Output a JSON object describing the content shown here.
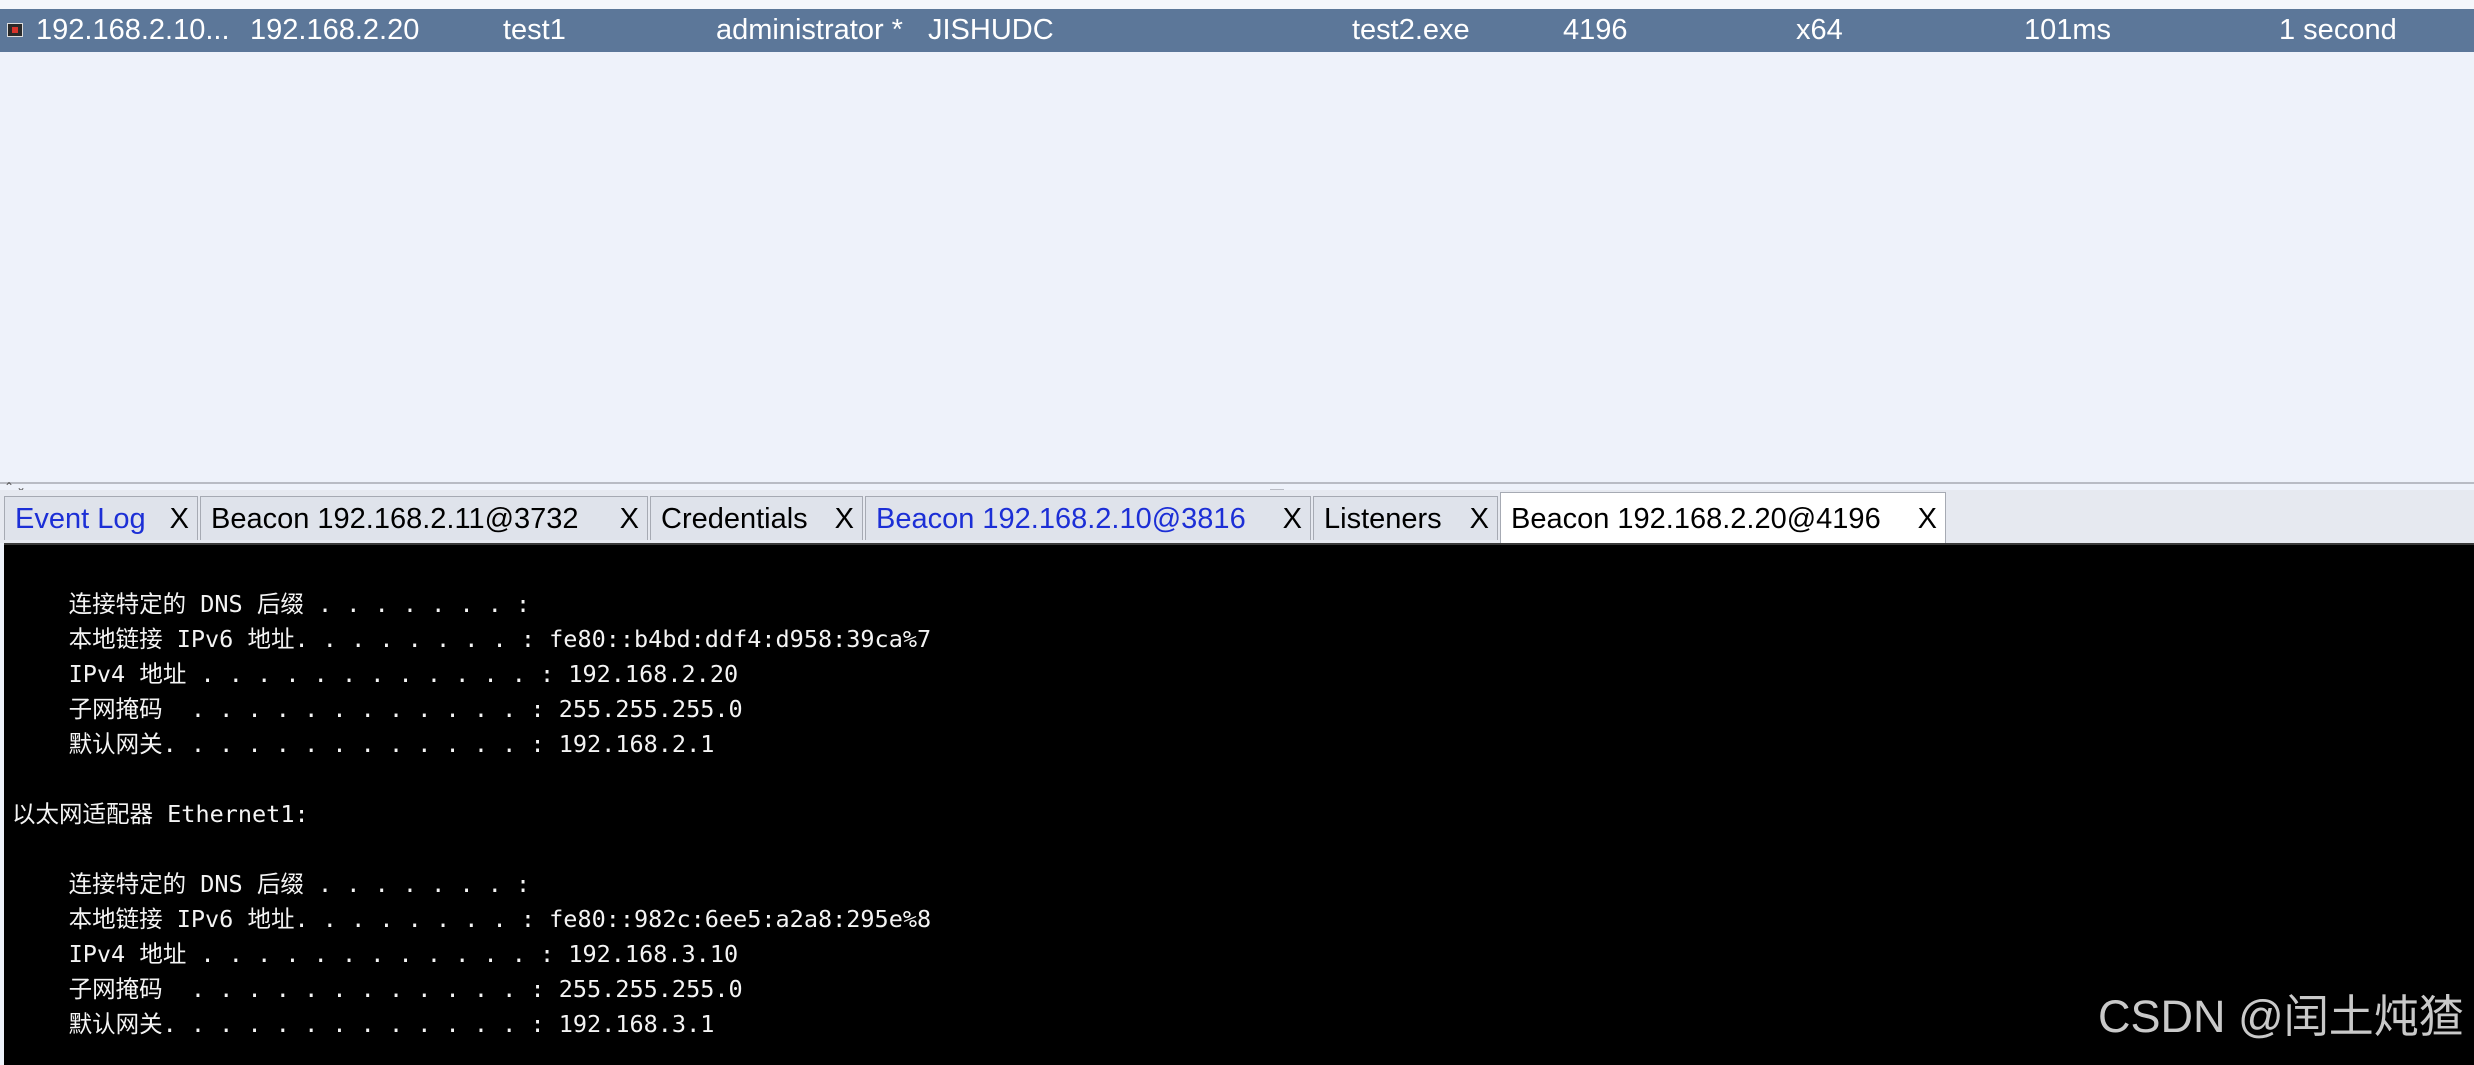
{
  "beacon_row": {
    "external": "192.168.2.10...",
    "internal": "192.168.2.20",
    "listener": "test1",
    "user": "administrator *",
    "computer": "JISHUDC",
    "process": "test2.exe",
    "pid": "4196",
    "arch": "x64",
    "sleep": "101ms",
    "last": "1 second"
  },
  "tabs": [
    {
      "label": "Event Log",
      "close": "X"
    },
    {
      "label": "Beacon 192.168.2.11@3732",
      "close": "X"
    },
    {
      "label": "Credentials",
      "close": "X"
    },
    {
      "label": "Beacon 192.168.2.10@3816",
      "close": "X"
    },
    {
      "label": "Listeners",
      "close": "X"
    },
    {
      "label": "Beacon 192.168.2.20@4196",
      "close": "X"
    }
  ],
  "console_lines": [
    "    连接特定的 DNS 后缀 . . . . . . . :",
    "    本地链接 IPv6 地址. . . . . . . . : fe80::b4bd:ddf4:d958:39ca%7",
    "    IPv4 地址 . . . . . . . . . . . . : 192.168.2.20",
    "    子网掩码  . . . . . . . . . . . . : 255.255.255.0",
    "    默认网关. . . . . . . . . . . . . : 192.168.2.1",
    "",
    "以太网适配器 Ethernet1:",
    "",
    "    连接特定的 DNS 后缀 . . . . . . . :",
    "    本地链接 IPv6 地址. . . . . . . . : fe80::982c:6ee5:a2a8:295e%8",
    "    IPv4 地址 . . . . . . . . . . . . : 192.168.3.10",
    "    子网掩码  . . . . . . . . . . . . : 255.255.255.0",
    "    默认网关. . . . . . . . . . . . . : 192.168.3.1"
  ],
  "watermark": "CSDN @闰土炖猹",
  "colors": {
    "selected_row": "#5c7799",
    "tab_link_blue": "#1c2fd6",
    "console_bg": "#000000"
  },
  "icons": {
    "beacon_row_icon": "beacon-session-icon"
  }
}
